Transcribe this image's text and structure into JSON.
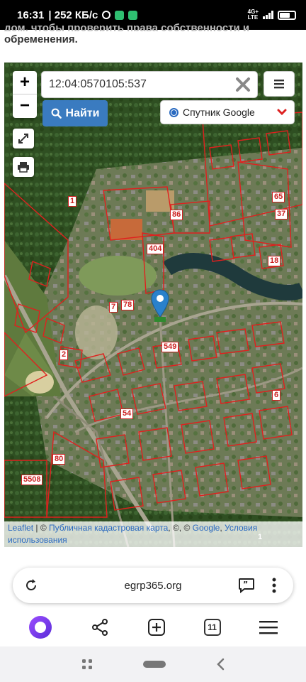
{
  "status_bar": {
    "time": "16:31",
    "speed": "| 252 КБ/с",
    "network": "4G+",
    "network_type": "LTE",
    "icons": [
      "alarm-icon",
      "app-icon",
      "whatsapp-icon",
      "signal-icon",
      "battery-icon"
    ]
  },
  "page": {
    "line1": "дом, чтобы проверить права собственности и",
    "line2": "обременения."
  },
  "map": {
    "zoom_in_label": "+",
    "zoom_out_label": "−",
    "search": {
      "value": "12:04:0570105:537",
      "placeholder": ""
    },
    "find_button_label": "Найти",
    "layer_select": {
      "selected": "Спутник Google"
    },
    "plot_labels": [
      "1",
      "86",
      "404",
      "65",
      "37",
      "18",
      "7",
      "78",
      "549",
      "2",
      "54",
      "6",
      "80",
      "5508",
      "1"
    ],
    "attribution": {
      "leaflet": "Leaflet",
      "sep1": " | © ",
      "kadastr": "Публичная кадастровая карта",
      "sep2": ", ©, © ",
      "google": "Google",
      "sep3": ", ",
      "terms": "Условия использования"
    },
    "colors": {
      "parcel_border": "#e0201e",
      "marker": "#2a81cb",
      "find_button": "#3a7bc0"
    }
  },
  "browser": {
    "url": "egrp365.org",
    "tabs_count": "11",
    "nav_icons": [
      "alice-icon",
      "share-icon",
      "new-tab-icon",
      "tabs-icon",
      "menu-icon"
    ]
  },
  "system_nav": {
    "icons": [
      "apps-icon",
      "home-pill-icon",
      "back-icon"
    ]
  }
}
